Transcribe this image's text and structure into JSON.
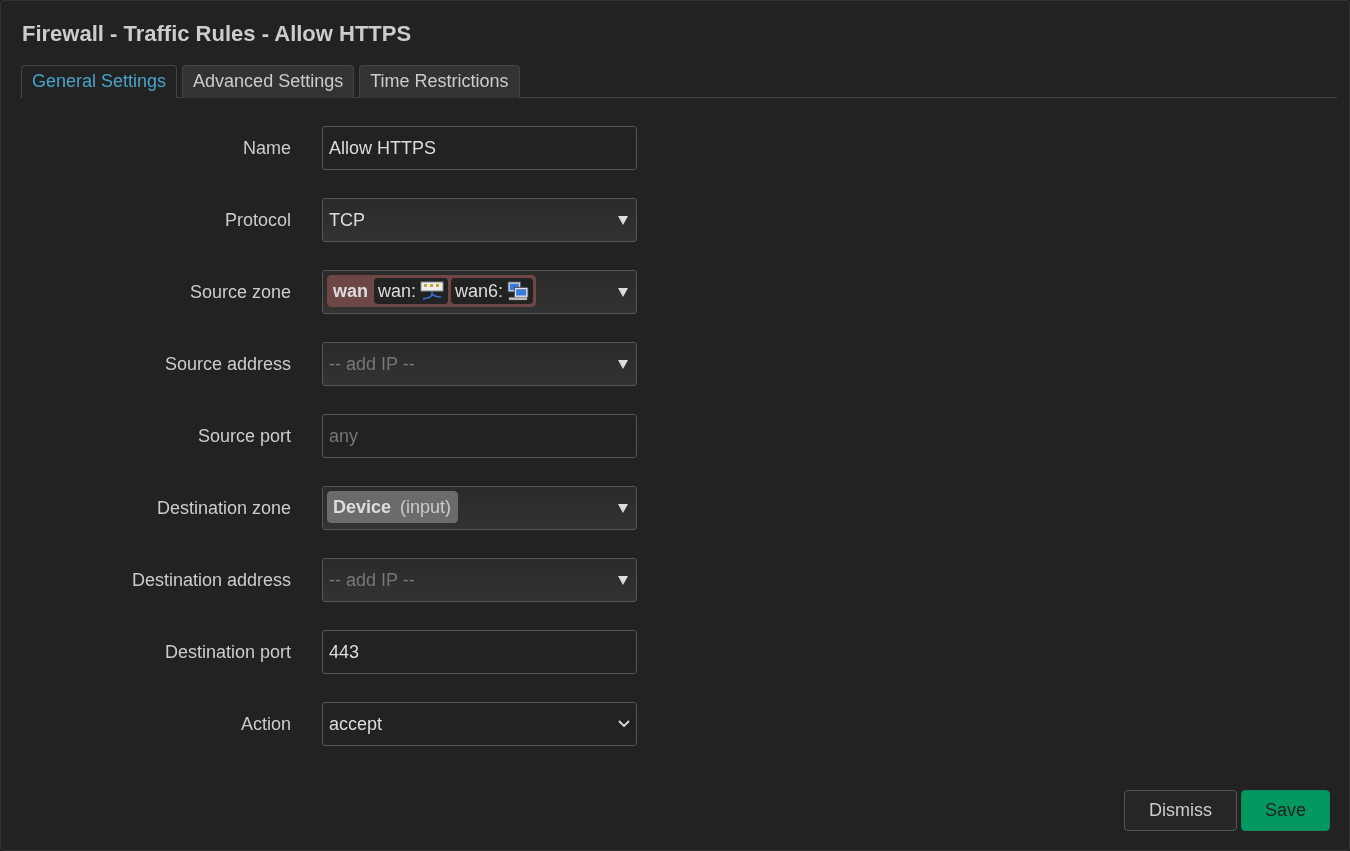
{
  "window": {
    "title": "Firewall - Traffic Rules - Allow HTTPS"
  },
  "tabs": [
    {
      "label": "General Settings",
      "selected": true
    },
    {
      "label": "Advanced Settings",
      "selected": false
    },
    {
      "label": "Time Restrictions",
      "selected": false
    }
  ],
  "fields": [
    {
      "label": "Name",
      "kind": "text",
      "value": "Allow HTTPS"
    },
    {
      "label": "Protocol",
      "kind": "select",
      "value": "TCP"
    },
    {
      "label": "Source zone",
      "kind": "zone",
      "zone": {
        "name": "wan",
        "color": "#6e4646",
        "networks": [
          {
            "label": "wan:",
            "kind": "ethernet"
          },
          {
            "label": "wan6:",
            "kind": "computers"
          }
        ]
      }
    },
    {
      "label": "Source address",
      "kind": "select",
      "placeholder": "-- add IP --"
    },
    {
      "label": "Source port",
      "kind": "text",
      "placeholder": "any"
    },
    {
      "label": "Destination zone",
      "kind": "zone",
      "zone": {
        "name": "Device",
        "suffix": "(input)",
        "color": "#6b6b6b"
      }
    },
    {
      "label": "Destination address",
      "kind": "select",
      "placeholder": "-- add IP --"
    },
    {
      "label": "Destination port",
      "kind": "text",
      "value": "443"
    },
    {
      "label": "Action",
      "kind": "dropdown",
      "value": "accept"
    }
  ],
  "buttons": [
    {
      "label": "Dismiss",
      "kind": "neutral"
    },
    {
      "label": "Save",
      "kind": "primary"
    }
  ]
}
